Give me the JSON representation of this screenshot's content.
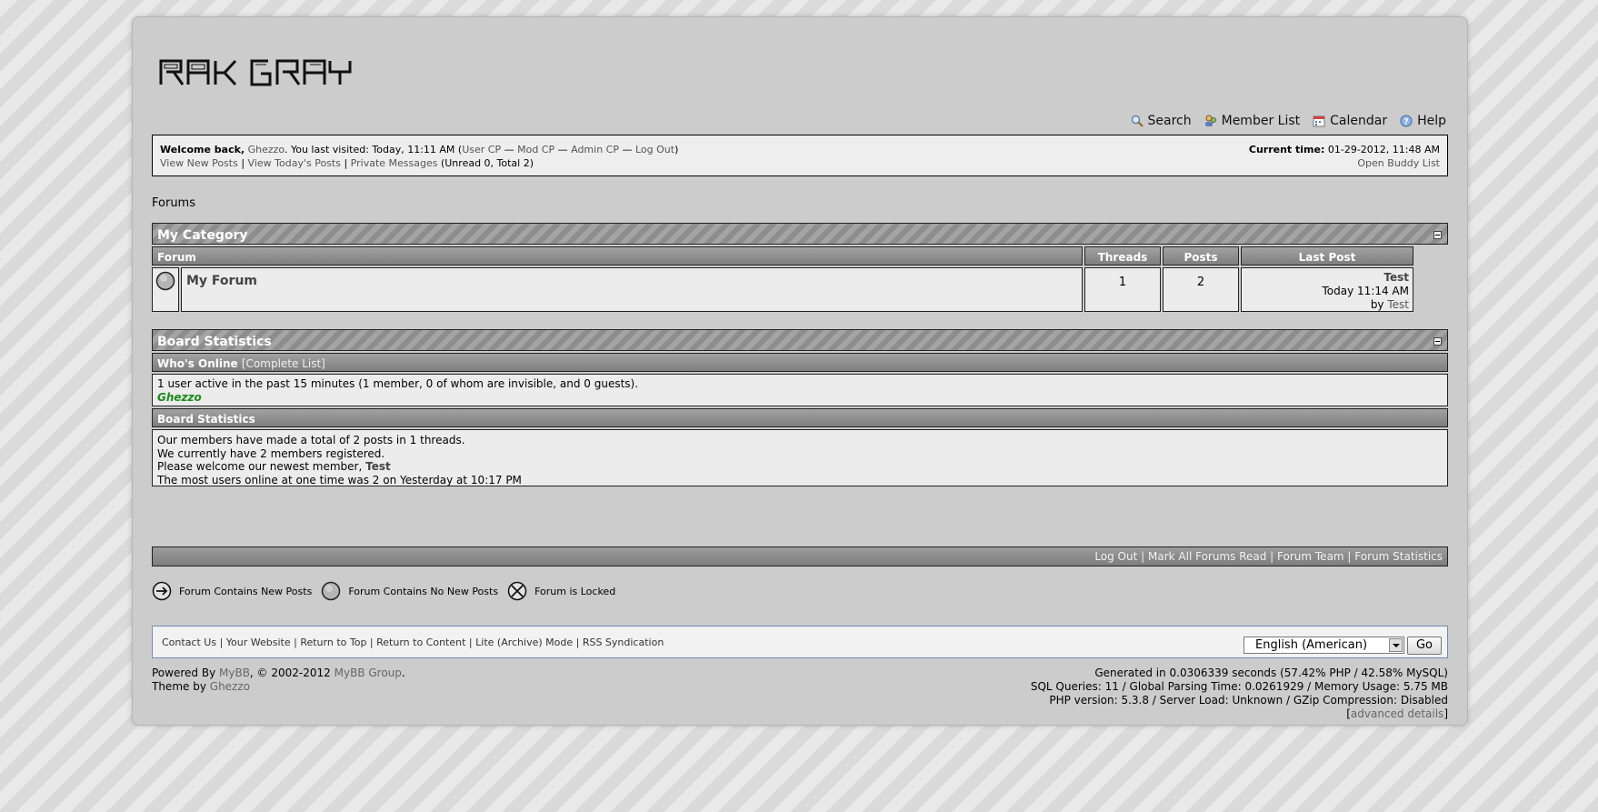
{
  "logo_text": "RAK GRAY",
  "menu": [
    {
      "label": "Search",
      "icon": "search-icon"
    },
    {
      "label": "Member List",
      "icon": "member-list-icon"
    },
    {
      "label": "Calendar",
      "icon": "calendar-icon"
    },
    {
      "label": "Help",
      "icon": "help-icon"
    }
  ],
  "welcome": {
    "prefix": "Welcome back,",
    "username": "Ghezzo",
    "last_visit": ". You last visited: Today, 11:11 AM (",
    "user_cp": "User CP",
    "sep": " — ",
    "mod_cp": "Mod CP",
    "admin_cp": "Admin CP",
    "logout": "Log Out",
    "close": ")",
    "view_new": "View New Posts",
    "bar": " | ",
    "view_today": "View Today's Posts",
    "pm": "Private Messages",
    "pm_counts": "(Unread 0, Total 2)",
    "current_time_label": "Current time:",
    "current_time": "01-29-2012, 11:48 AM",
    "buddy": "Open Buddy List"
  },
  "breadcrumb": "Forums",
  "category": {
    "title": "My Category",
    "headers": {
      "forum": "Forum",
      "threads": "Threads",
      "posts": "Posts",
      "lastpost": "Last Post"
    },
    "forums": [
      {
        "name": "My Forum",
        "threads": "1",
        "posts": "2",
        "last_title": "Test",
        "last_time": "Today 11:14 AM",
        "last_by": "by",
        "last_user": "Test"
      }
    ]
  },
  "stats": {
    "title": "Board Statistics",
    "online_header": "Who's Online",
    "complete_list": "[Complete List]",
    "online_text": "1 user active in the past 15 minutes (1 member, 0 of whom are invisible, and 0 guests).",
    "online_user": "Ghezzo",
    "stats_header": "Board Statistics",
    "line1": "Our members have made a total of 2 posts in 1 threads.",
    "line2": "We currently have 2 members registered.",
    "line3_prefix": "Please welcome our newest member,",
    "line3_user": "Test",
    "line4": "The most users online at one time was 2 on Yesterday at 10:17 PM"
  },
  "footer_links": [
    "Log Out",
    "Mark All Forums Read",
    "Forum Team",
    "Forum Statistics"
  ],
  "legend": [
    "Forum Contains New Posts",
    "Forum Contains No New Posts",
    "Forum is Locked"
  ],
  "bottom_links": [
    "Contact Us",
    "Your Website",
    "Return to Top",
    "Return to Content",
    "Lite (Archive) Mode",
    "RSS Syndication"
  ],
  "language": "English (American)",
  "go": "Go",
  "powered": {
    "prefix": "Powered By",
    "mybb": "MyBB",
    "mid": ", © 2002-2012",
    "group": "MyBB Group",
    "end": ".",
    "theme_prefix": "Theme by",
    "theme_author": "Ghezzo"
  },
  "debug": {
    "line1": "Generated in 0.0306339 seconds (57.42% PHP / 42.58% MySQL)",
    "line2": "SQL Queries: 11 / Global Parsing Time: 0.0261929 / Memory Usage: 5.75 MB",
    "line3": "PHP version: 5.3.8 / Server Load: Unknown / GZip Compression: Disabled",
    "open": "[",
    "advanced": "advanced details",
    "close": "]"
  }
}
